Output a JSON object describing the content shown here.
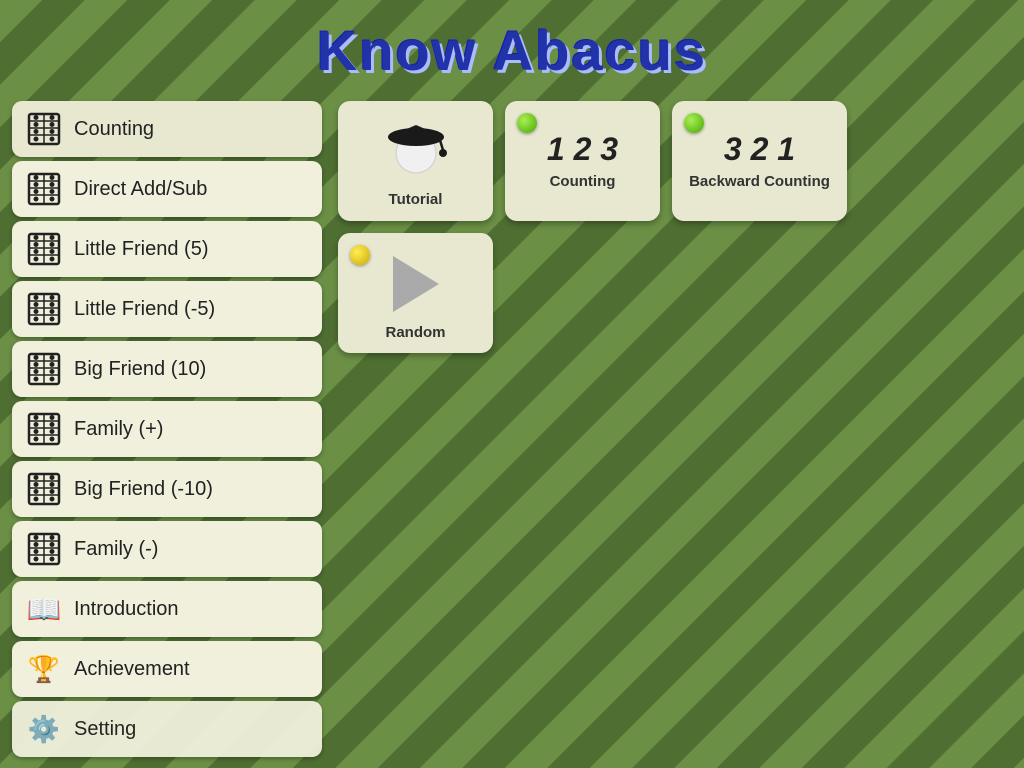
{
  "app": {
    "title": "Know Abacus"
  },
  "sidebar": {
    "items": [
      {
        "id": "counting",
        "label": "Counting",
        "icon": "abacus",
        "active": true
      },
      {
        "id": "direct-add-sub",
        "label": "Direct Add/Sub",
        "icon": "abacus"
      },
      {
        "id": "little-friend-5",
        "label": "Little Friend (5)",
        "icon": "abacus"
      },
      {
        "id": "little-friend-neg5",
        "label": "Little Friend (-5)",
        "icon": "abacus"
      },
      {
        "id": "big-friend-10",
        "label": "Big Friend (10)",
        "icon": "abacus"
      },
      {
        "id": "family-plus",
        "label": "Family (+)",
        "icon": "abacus"
      },
      {
        "id": "big-friend-neg10",
        "label": "Big Friend (-10)",
        "icon": "abacus"
      },
      {
        "id": "family-minus",
        "label": "Family (-)",
        "icon": "abacus"
      },
      {
        "id": "introduction",
        "label": "Introduction",
        "icon": "book"
      },
      {
        "id": "achievement",
        "label": "Achievement",
        "icon": "trophy"
      },
      {
        "id": "setting",
        "label": "Setting",
        "icon": "gear"
      }
    ]
  },
  "main": {
    "cards": [
      {
        "id": "tutorial",
        "label": "Tutorial",
        "type": "tutorial",
        "dot": "none"
      },
      {
        "id": "123-counting",
        "label": "Counting",
        "number": "1 2 3",
        "type": "number",
        "dot": "green"
      },
      {
        "id": "backward-counting",
        "label": "Backward Counting",
        "number": "3 2 1",
        "type": "number",
        "dot": "green"
      }
    ],
    "second_row": [
      {
        "id": "random",
        "label": "Random",
        "type": "play",
        "dot": "yellow"
      }
    ]
  }
}
